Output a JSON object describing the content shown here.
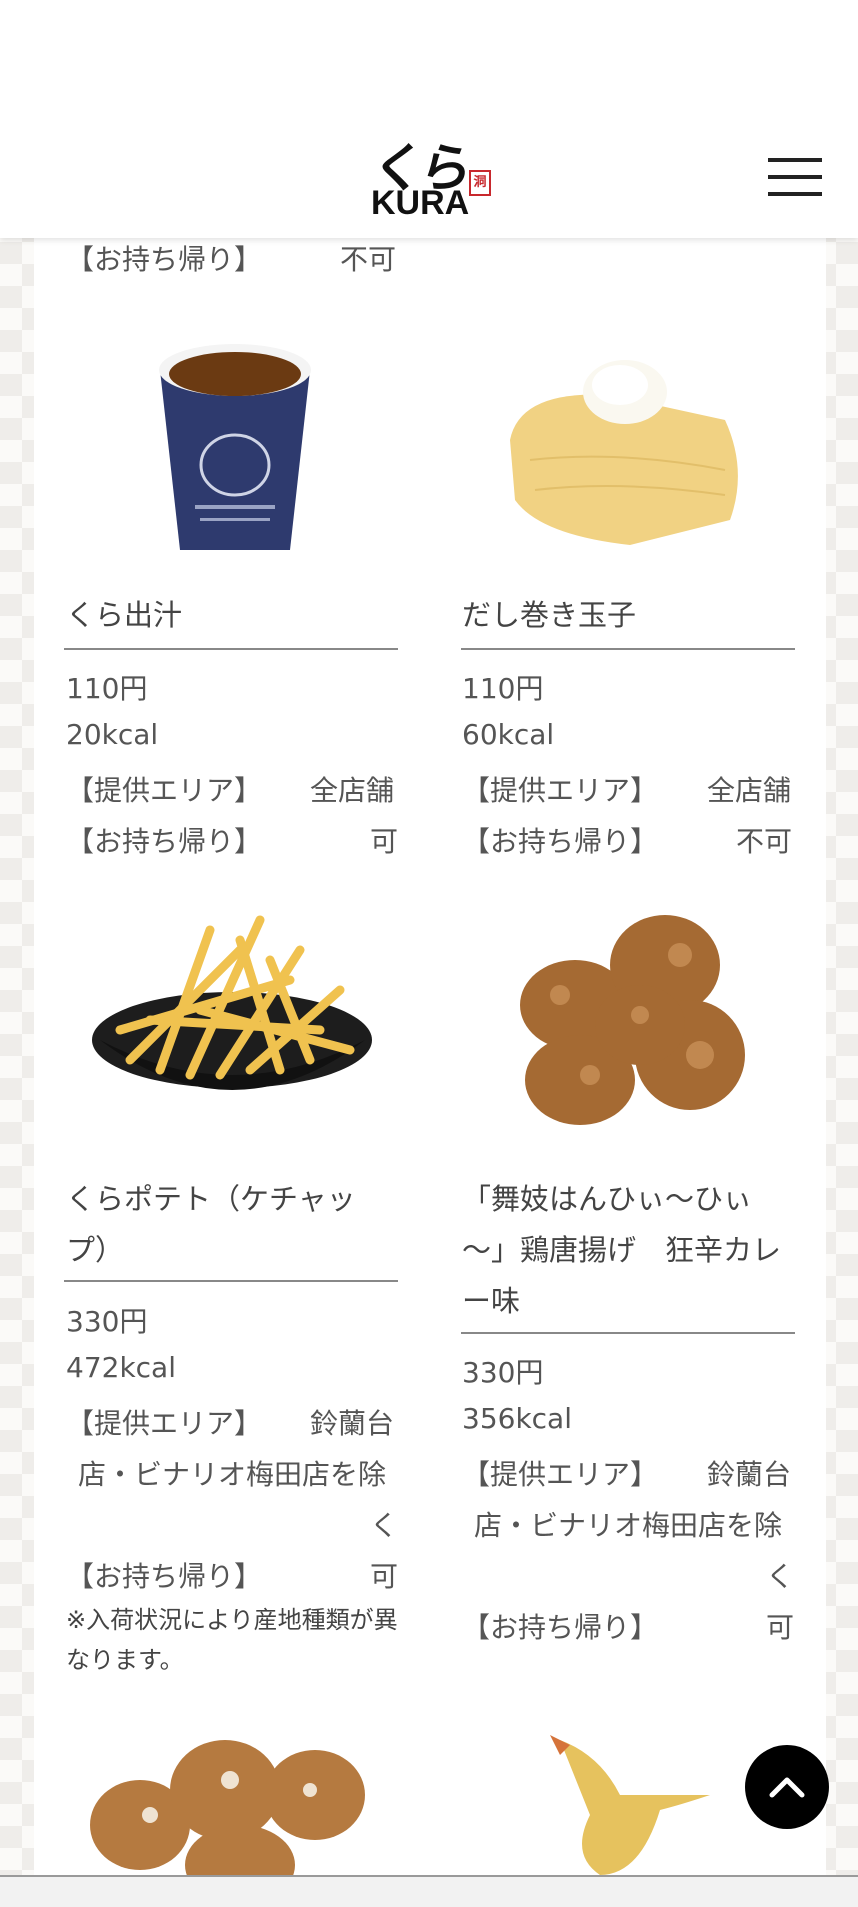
{
  "header": {
    "logo_mark": "くら",
    "logo_word": "KURA",
    "logo_stamp": "洞"
  },
  "top_partial": {
    "takeout_label": "【お持ち帰り】",
    "takeout_value": "不可"
  },
  "items": [
    {
      "name": "くら出汁",
      "price": "110円",
      "kcal": "20kcal",
      "area_label": "【提供エリア】",
      "area_value": "全店舗",
      "takeout_label": "【お持ち帰り】",
      "takeout_value": "可"
    },
    {
      "name": "だし巻き玉子",
      "price": "110円",
      "kcal": "60kcal",
      "area_label": "【提供エリア】",
      "area_value": "全店舗",
      "takeout_label": "【お持ち帰り】",
      "takeout_value": "不可"
    },
    {
      "name_line1": "くらポテト（ケチャッ",
      "name_line2": "プ）",
      "price": "330円",
      "kcal": "472kcal",
      "area_label": "【提供エリア】",
      "area_value_1": "鈴蘭台",
      "area_value_2": "店・ビナリオ梅田店を除",
      "area_value_3": "く",
      "takeout_label": "【お持ち帰り】",
      "takeout_value": "可",
      "note_line1": "※入荷状況により産地種類が異",
      "note_line2": "なります。"
    },
    {
      "name_line1": "「舞妓はんひぃ〜ひぃ",
      "name_line2": "〜」鶏唐揚げ　狂辛カレ",
      "name_line3": "ー味",
      "price": "330円",
      "kcal": "356kcal",
      "area_label": "【提供エリア】",
      "area_value_1": "鈴蘭台",
      "area_value_2": "店・ビナリオ梅田店を除",
      "area_value_3": "く",
      "takeout_label": "【お持ち帰り】",
      "takeout_value": "可"
    }
  ],
  "icons": {
    "menu": "hamburger-menu-icon",
    "scroll_top": "chevron-up-icon"
  }
}
